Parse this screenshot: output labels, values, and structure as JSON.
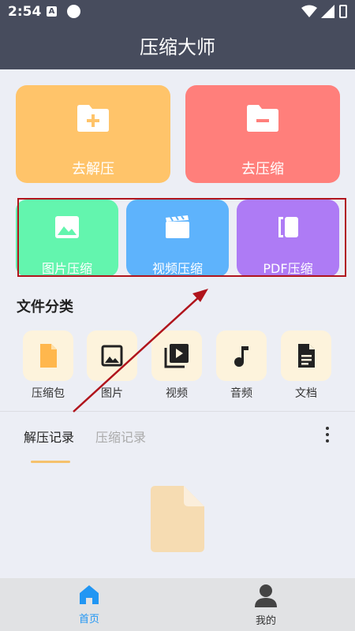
{
  "status_bar": {
    "time": "2:54",
    "a_icon": "A"
  },
  "app": {
    "title": "压缩大师"
  },
  "big_actions": [
    {
      "label": "去解压",
      "color": "#ffc46a",
      "icon": "folder-plus-icon"
    },
    {
      "label": "去压缩",
      "color": "#ff7f7b",
      "icon": "folder-minus-icon"
    }
  ],
  "media_actions": [
    {
      "label": "图片压缩",
      "color": "#63f5ae",
      "icon": "image-icon"
    },
    {
      "label": "视频压缩",
      "color": "#5eb3fc",
      "icon": "video-icon"
    },
    {
      "label": "PDF压缩",
      "color": "#ae7bf5",
      "icon": "pdf-icon"
    }
  ],
  "categories": {
    "title": "文件分类",
    "items": [
      {
        "label": "压缩包",
        "icon": "archive-file-icon"
      },
      {
        "label": "图片",
        "icon": "picture-icon"
      },
      {
        "label": "视频",
        "icon": "video-library-icon"
      },
      {
        "label": "音频",
        "icon": "music-note-icon"
      },
      {
        "label": "文档",
        "icon": "document-icon"
      }
    ]
  },
  "records": {
    "tabs": [
      "解压记录",
      "压缩记录"
    ],
    "active_tab": "解压记录"
  },
  "bottom_nav": [
    {
      "label": "首页",
      "icon": "home-icon",
      "active": true
    },
    {
      "label": "我的",
      "icon": "person-icon",
      "active": false
    }
  ],
  "colors": {
    "header": "#474c5d",
    "accent": "#2196f3",
    "tab_underline": "#f5c16c",
    "annotation": "#b0141c"
  }
}
